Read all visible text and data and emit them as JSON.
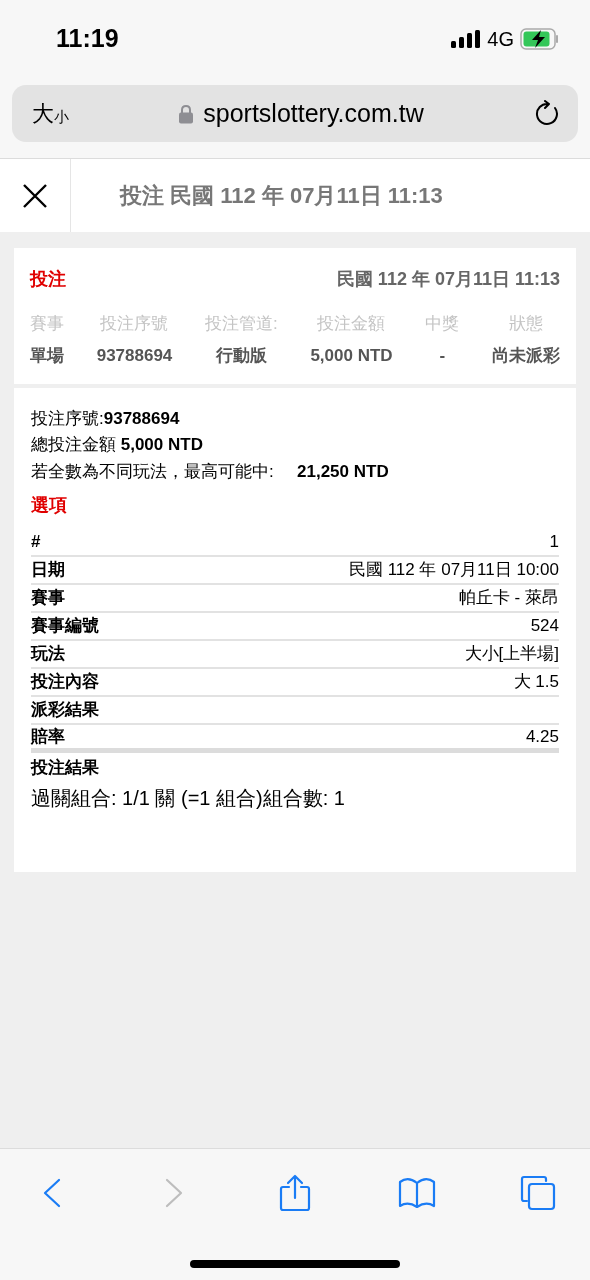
{
  "status_bar": {
    "time": "11:19",
    "network": "4G"
  },
  "address_bar": {
    "text_size_large": "大",
    "text_size_small": "小",
    "url": "sportslottery.com.tw"
  },
  "header": {
    "title": "投注 民國 112 年 07月11日 11:13"
  },
  "summary": {
    "title": "投注",
    "date": "民國 112 年 07月11日 11:13",
    "columns": [
      {
        "heading": "賽事",
        "value": "單場"
      },
      {
        "heading": "投注序號",
        "value": "93788694"
      },
      {
        "heading": "投注管道:",
        "value": "行動版"
      },
      {
        "heading": "投注金額",
        "value": "5,000 NTD"
      },
      {
        "heading": "中獎",
        "value": "-"
      },
      {
        "heading": "狀態",
        "value": "尚未派彩"
      }
    ]
  },
  "detail": {
    "serial": "投注序號:**93788694**",
    "total": "總投注金額 **5,000 NTD**",
    "max_win_label": "若全數為不同玩法，最高可能中:",
    "max_win_value": "21,250 NTD",
    "options_title": "選項",
    "rows": [
      {
        "label": "#",
        "value": "1"
      },
      {
        "label": "日期",
        "value": "民國 112 年 07月11日 10:00"
      },
      {
        "label": "賽事",
        "value": "帕丘卡 - 萊昂"
      },
      {
        "label": "賽事編號",
        "value": "524"
      },
      {
        "label": "玩法",
        "value": "大小[上半場]"
      },
      {
        "label": "投注內容",
        "value": "大 1.5"
      },
      {
        "label": "派彩結果"
      },
      {
        "label": "賠率",
        "value": "4.25"
      }
    ],
    "result_title": "投注結果",
    "result_text": "過關組合: 1/1 關 (=1 組合)組合數: 1"
  },
  "toolbar": [
    {
      "kind": "back",
      "disabled": false
    },
    {
      "kind": "forward",
      "disabled": true
    },
    {
      "kind": "share",
      "disabled": false
    },
    {
      "kind": "bookmarks",
      "disabled": false
    },
    {
      "kind": "tabs",
      "disabled": false
    }
  ]
}
